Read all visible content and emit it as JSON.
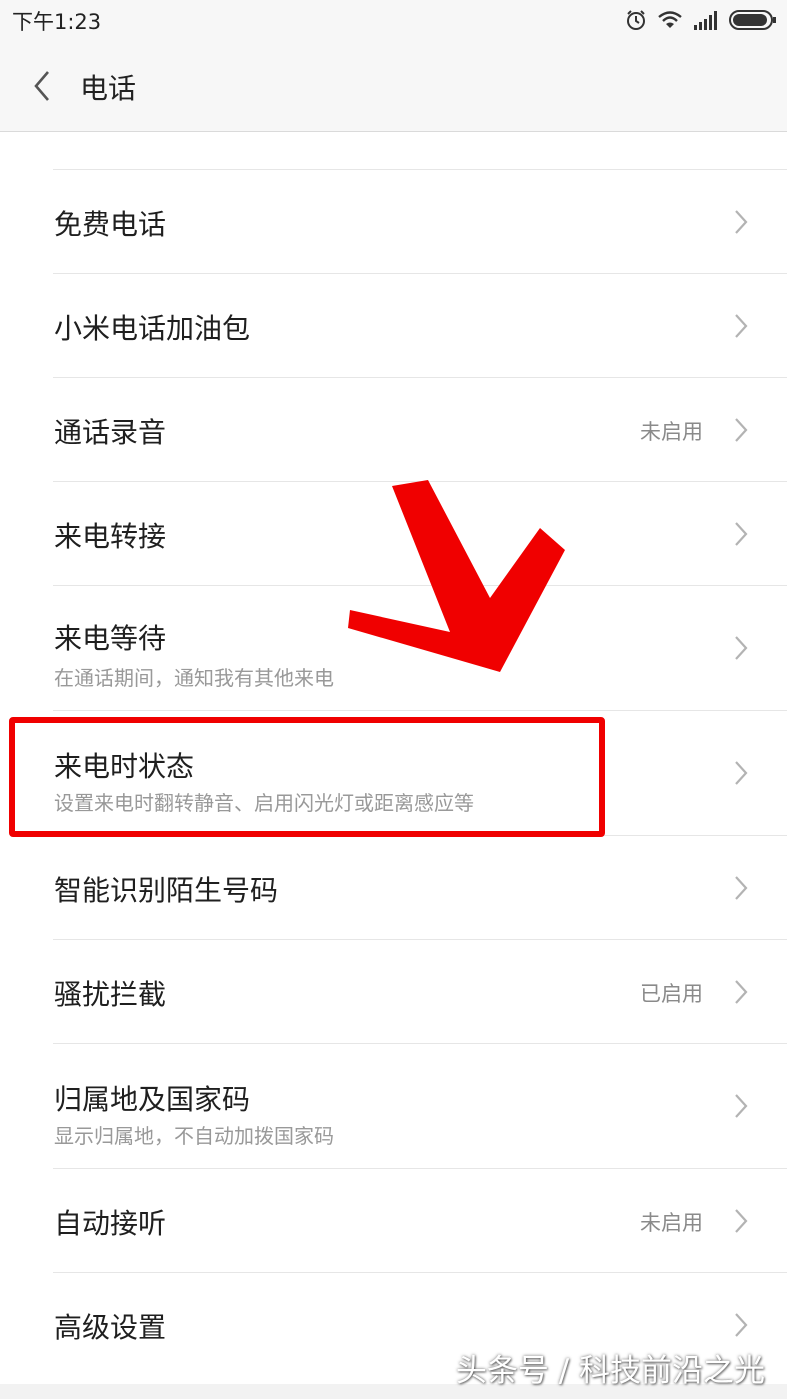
{
  "status_bar": {
    "time": "下午1:23",
    "icons": [
      "alarm-icon",
      "wifi-icon",
      "signal-icon",
      "battery-icon"
    ]
  },
  "header": {
    "title": "电话",
    "back_icon": "chevron-left-icon"
  },
  "settings": [
    {
      "title": "免费电话",
      "subtitle": "",
      "value": ""
    },
    {
      "title": "小米电话加油包",
      "subtitle": "",
      "value": ""
    },
    {
      "title": "通话录音",
      "subtitle": "",
      "value": "未启用"
    },
    {
      "title": "来电转接",
      "subtitle": "",
      "value": ""
    },
    {
      "title": "来电等待",
      "subtitle": "在通话期间，通知我有其他来电",
      "value": ""
    },
    {
      "title": "来电时状态",
      "subtitle": "设置来电时翻转静音、启用闪光灯或距离感应等",
      "value": ""
    },
    {
      "title": "智能识别陌生号码",
      "subtitle": "",
      "value": ""
    },
    {
      "title": "骚扰拦截",
      "subtitle": "",
      "value": "已启用"
    },
    {
      "title": "归属地及国家码",
      "subtitle": "显示归属地，不自动加拨国家码",
      "value": ""
    },
    {
      "title": "自动接听",
      "subtitle": "",
      "value": "未启用"
    },
    {
      "title": "高级设置",
      "subtitle": "",
      "value": ""
    }
  ],
  "annotation": {
    "color": "#f00000",
    "highlighted_item": "来电时状态"
  },
  "watermark": "头条号 / 科技前沿之光"
}
